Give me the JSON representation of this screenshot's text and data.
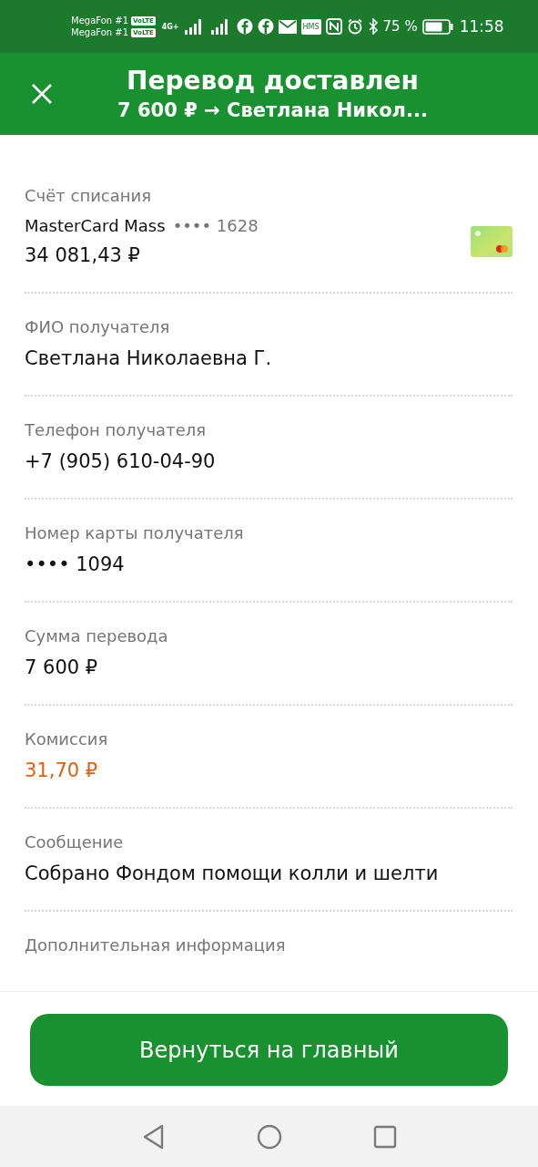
{
  "status_bar": {
    "carriers": [
      {
        "name": "MegaFon #1",
        "badge": "VoLTE"
      },
      {
        "name": "MegaFon #1",
        "badge": "VoLTE"
      }
    ],
    "network": "4G+",
    "notification_badge": "HMS",
    "battery": "75 %",
    "time": "11:58"
  },
  "header": {
    "title": "Перевод доставлен",
    "subtitle": "7 600 ₽ → Светлана Никол..."
  },
  "fields": [
    {
      "kind": "account",
      "label": "Счёт списания",
      "card_name": "MasterCard Mass",
      "card_mask": "•••• 1628",
      "value": "34 081,43 ₽"
    },
    {
      "kind": "text",
      "label": "ФИО получателя",
      "value": "Светлана Николаевна Г."
    },
    {
      "kind": "text",
      "label": "Телефон получателя",
      "value": "+7 (905) 610-04-90"
    },
    {
      "kind": "text",
      "label": "Номер карты получателя",
      "value": "•••• 1094"
    },
    {
      "kind": "text",
      "label": "Сумма перевода",
      "value": "7 600 ₽"
    },
    {
      "kind": "fee",
      "label": "Комиссия",
      "value": "31,70 ₽"
    },
    {
      "kind": "text",
      "label": "Сообщение",
      "value": "Собрано Фондом помощи колли и шелти"
    },
    {
      "kind": "label_only",
      "label": "Дополнительная информация"
    }
  ],
  "button": "Вернуться на главный"
}
